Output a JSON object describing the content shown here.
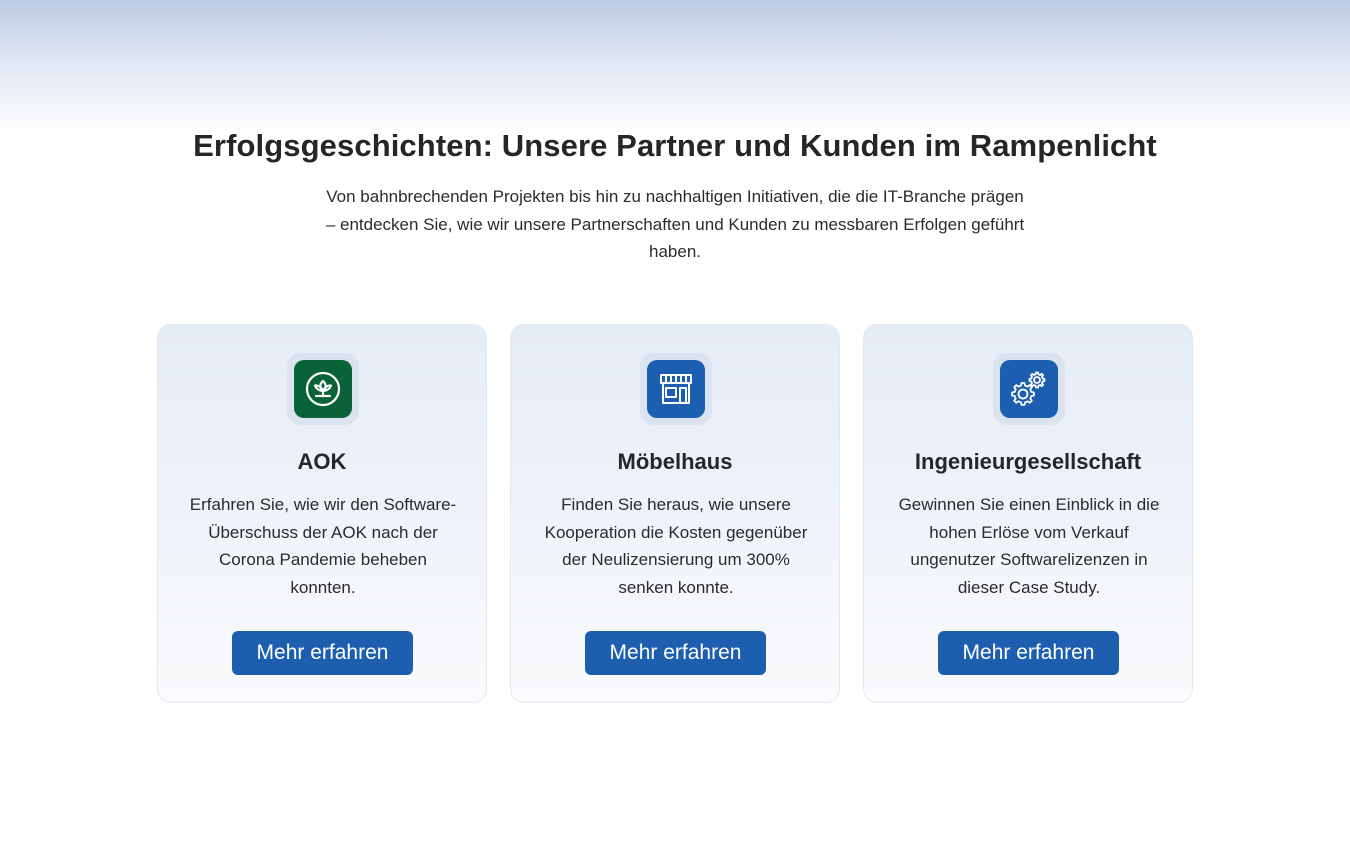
{
  "section": {
    "title": "Erfolgsgeschichten: Unsere Partner und Kunden im Rampenlicht",
    "intro": "Von bahnbrechenden Projekten bis hin zu nachhaltigen Initiativen, die die IT-Branche prägen – entdecken Sie, wie wir  unsere Partnerschaften und Kunden zu messbaren Erfolgen geführt haben."
  },
  "colors": {
    "button": "#1d5fae",
    "aok_icon_bg": "#0a6338",
    "blue_icon_bg": "#1c5eb0"
  },
  "cards": [
    {
      "icon": "aok-logo-icon",
      "title": "AOK",
      "text": "Erfahren Sie, wie wir den Software-Überschuss der AOK nach der Corona Pandemie beheben konnten.",
      "button": "Mehr erfahren"
    },
    {
      "icon": "storefront-icon",
      "title": "Möbelhaus",
      "text": "Finden Sie heraus, wie unsere Kooperation die Kosten gegenüber der Neulizensierung um 300% senken konnte.",
      "button": "Mehr erfahren"
    },
    {
      "icon": "gears-icon",
      "title": "Ingenieurgesellschaft",
      "text": "Gewinnen Sie einen Einblick in die hohen Erlöse vom Verkauf ungenutzer Softwarelizenzen in dieser Case Study.",
      "button": "Mehr erfahren"
    }
  ]
}
